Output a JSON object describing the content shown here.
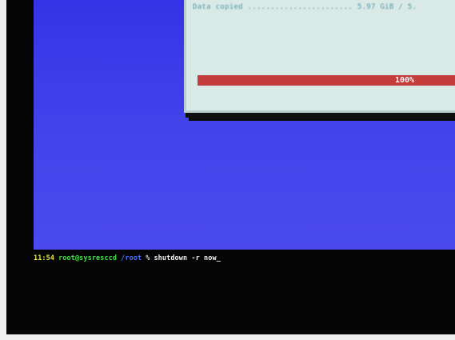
{
  "dialog": {
    "line_text": "Data copied ....................... 5.97 GiB / 5.",
    "progress_percent": 100,
    "progress_label": "100%"
  },
  "terminal": {
    "time": "11:54",
    "user_host": "root@sysresccd",
    "path": "/root",
    "separator": "%",
    "command": "shutdown -r now",
    "cursor": "_"
  },
  "colors": {
    "background_blue": "#3e3ee8",
    "dialog_bg": "#d9e9e6",
    "progress_red": "#c63a3a",
    "time_color": "#e6ea46",
    "user_color": "#45e04c",
    "path_color": "#4b72ff"
  }
}
